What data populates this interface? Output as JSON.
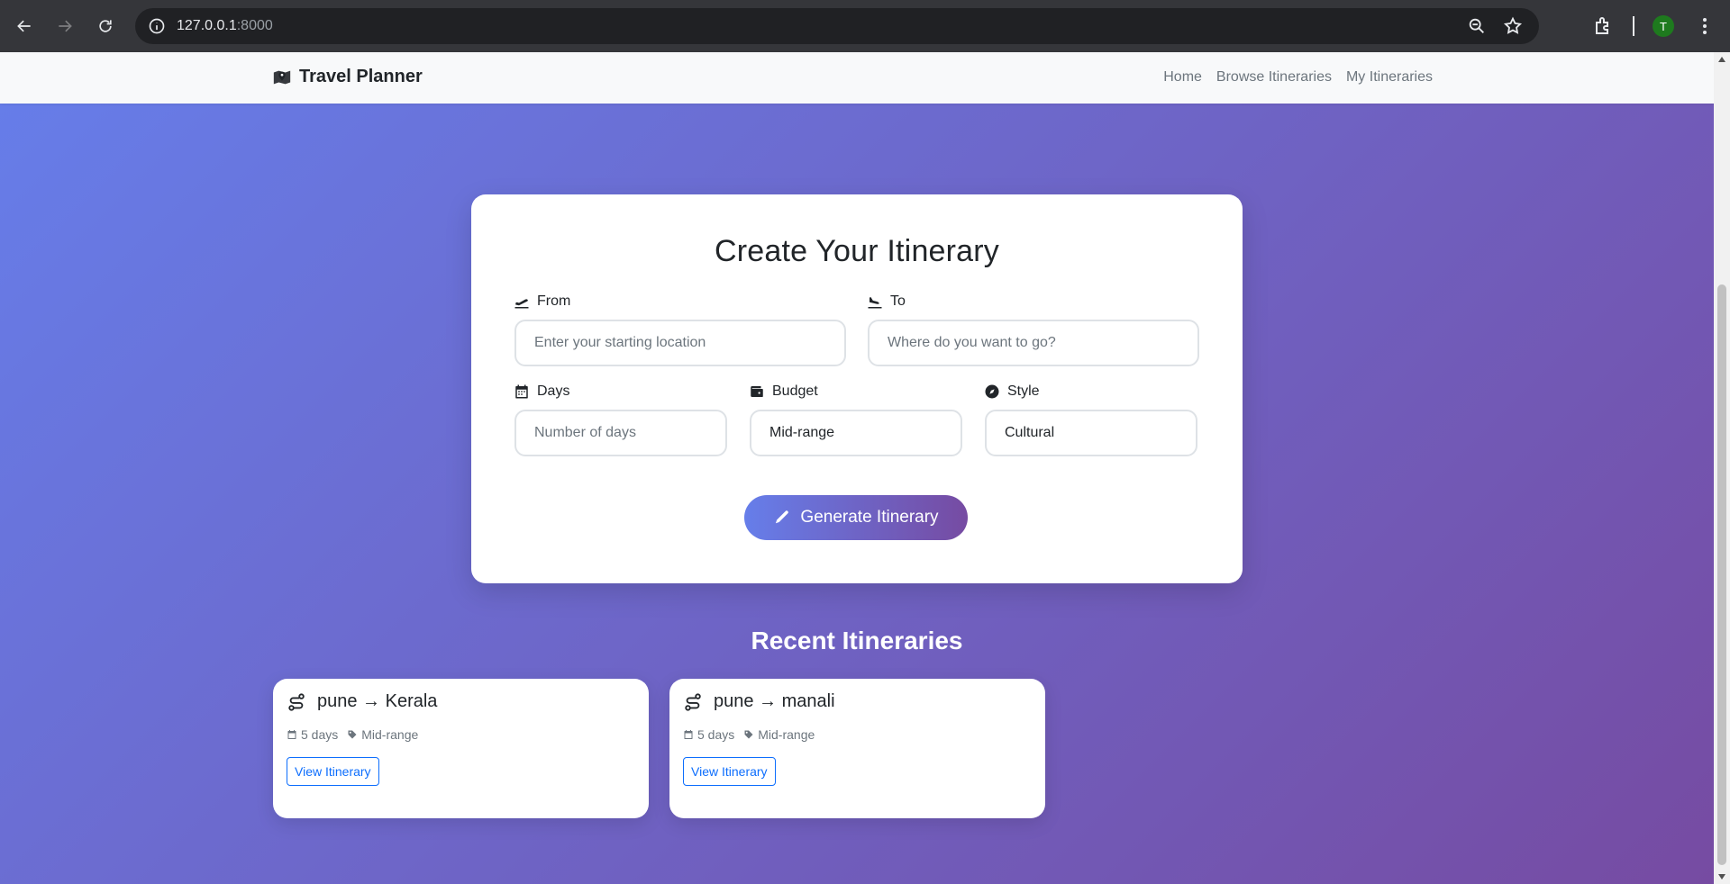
{
  "browser": {
    "url_host": "127.0.0.1",
    "url_port": ":8000",
    "profile_initial": "T"
  },
  "navbar": {
    "brand": "Travel Planner",
    "links": [
      "Home",
      "Browse Itineraries",
      "My Itineraries"
    ]
  },
  "form": {
    "title": "Create Your Itinerary",
    "from_label": "From",
    "from_placeholder": "Enter your starting location",
    "to_label": "To",
    "to_placeholder": "Where do you want to go?",
    "days_label": "Days",
    "days_placeholder": "Number of days",
    "budget_label": "Budget",
    "budget_value": "Mid-range",
    "style_label": "Style",
    "style_value": "Cultural",
    "submit_label": "Generate Itinerary"
  },
  "recent": {
    "title": "Recent Itineraries",
    "items": [
      {
        "route": "pune → Kerala",
        "days": "5 days",
        "budget": "Mid-range",
        "button": "View Itinerary"
      },
      {
        "route": "pune → manali",
        "days": "5 days",
        "budget": "Mid-range",
        "button": "View Itinerary"
      }
    ]
  }
}
